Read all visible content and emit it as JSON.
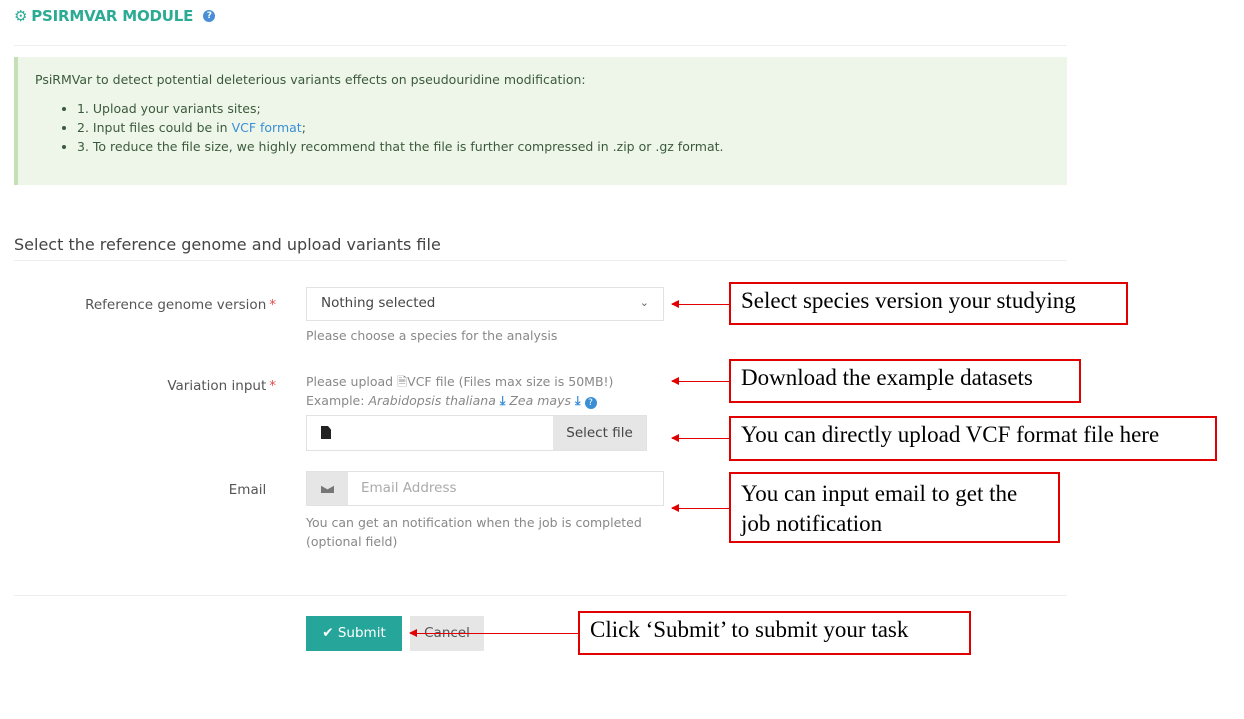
{
  "header": {
    "title": "PSIRMVAR MODULE",
    "icon": "cogs-icon",
    "help_icon": "question-circle-icon"
  },
  "info": {
    "intro": "PsiRMVar to detect potential deleterious variants effects on pseudouridine modification:",
    "items": [
      {
        "text": "1. Upload your variants sites;"
      },
      {
        "prefix": "2. Input files could be in ",
        "link": "VCF format",
        "suffix": ";"
      },
      {
        "text": "3. To reduce the file size, we highly recommend that the file is further compressed in .zip or .gz format."
      }
    ]
  },
  "section_title": "Select the reference genome and upload variants file",
  "form": {
    "genome": {
      "label": "Reference genome version",
      "required": "*",
      "selected": "Nothing selected",
      "help": "Please choose a species for the analysis"
    },
    "variation": {
      "label": "Variation input",
      "required": "*",
      "upload_prefix": "Please upload",
      "upload_suffix": "VCF file (Files max size is 50MB!)",
      "example_label": "Example:",
      "example_1": "Arabidopsis thaliana",
      "example_2": "Zea mays",
      "select_file": "Select file"
    },
    "email": {
      "label": "Email",
      "placeholder": "Email Address",
      "help": "You can get an notification when the job is completed (optional field)"
    }
  },
  "buttons": {
    "submit": "Submit",
    "cancel": "Cancel"
  },
  "annotations": {
    "genome": "Select species version your studying",
    "download": "Download the example datasets",
    "upload": "You can directly upload VCF format file here",
    "email": "You can input email to get the job notification",
    "submit": "Click ‘Submit’ to submit your task"
  },
  "colors": {
    "accent": "#2bab93",
    "submit": "#26a69a",
    "annotation": "#e00000",
    "link": "#3a8ed6"
  }
}
